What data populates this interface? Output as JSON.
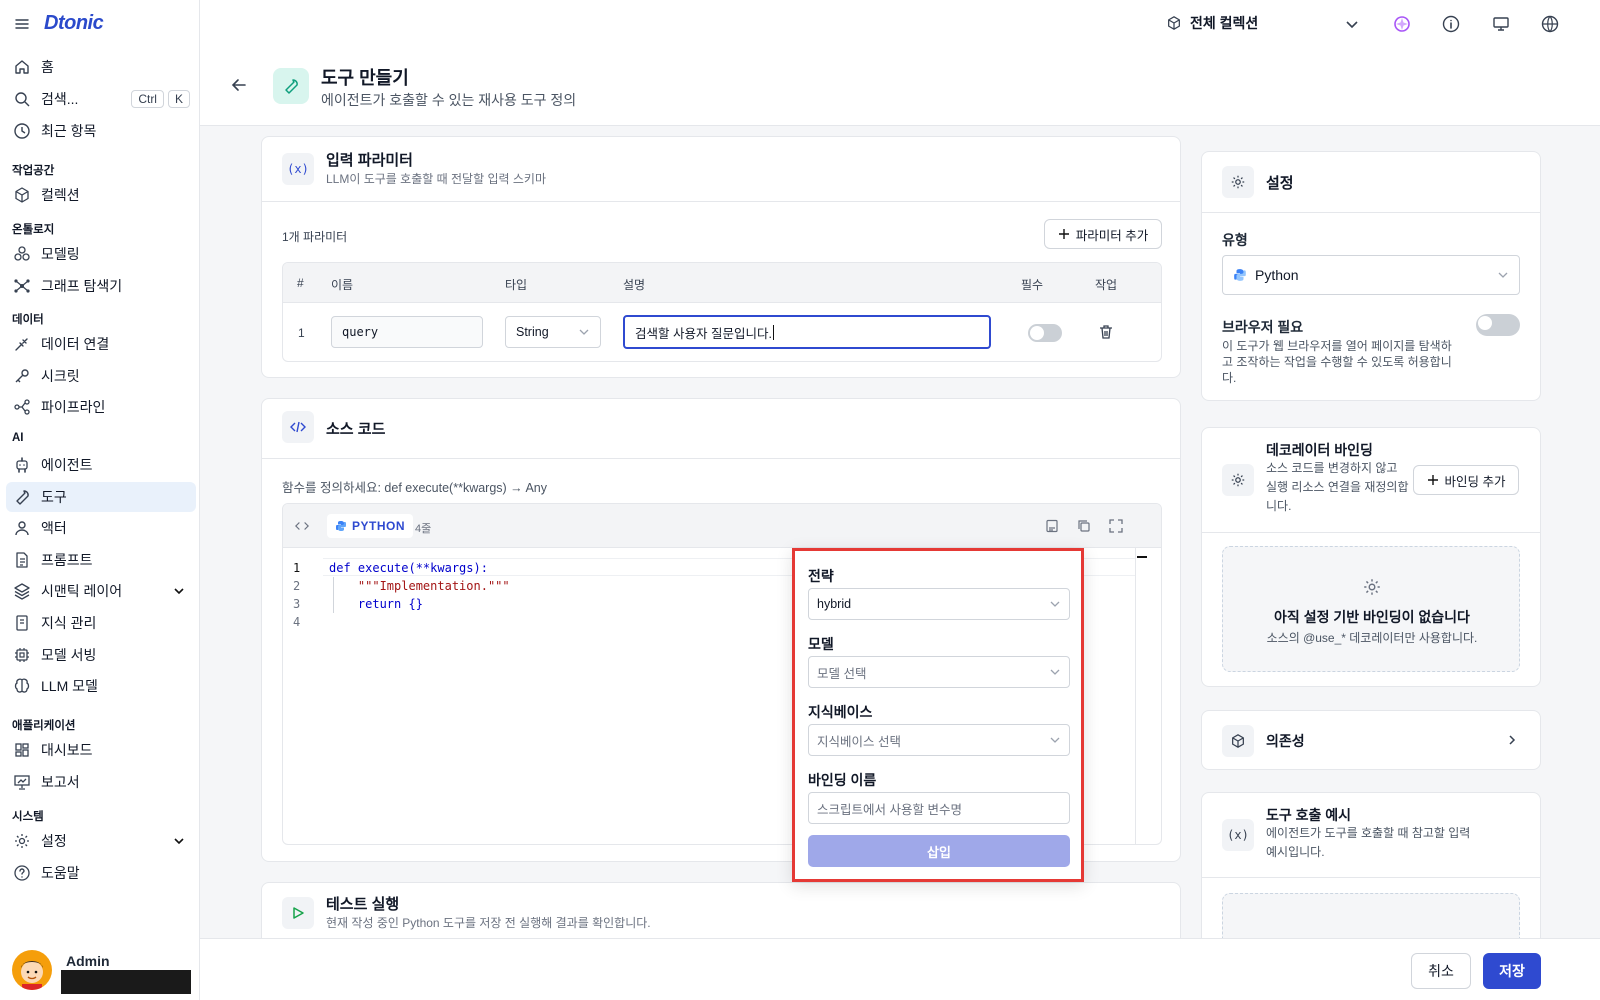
{
  "brand": {
    "logo": "Dtonic"
  },
  "sidebar": {
    "home": "홈",
    "search": "검색...",
    "search_kbd1": "Ctrl",
    "search_kbd2": "K",
    "recent": "최근 항목",
    "sec_workspace": "작업공간",
    "collection": "컬렉션",
    "sec_ontology": "온톨로지",
    "modeling": "모델링",
    "graph_explorer": "그래프 탐색기",
    "sec_data": "데이터",
    "data_connect": "데이터 연결",
    "secret": "시크릿",
    "pipeline": "파이프라인",
    "sec_ai": "AI",
    "agent": "에이전트",
    "tool": "도구",
    "actor": "액터",
    "prompt": "프롬프트",
    "semantic_layer": "시맨틱 레이어",
    "knowledge": "지식 관리",
    "model_serving": "모델 서빙",
    "llm_model": "LLM 모델",
    "sec_apps": "애플리케이션",
    "dashboard": "대시보드",
    "report": "보고서",
    "sec_system": "시스템",
    "settings": "설정",
    "help": "도움말",
    "user_name": "Admin"
  },
  "topbar": {
    "collection_selector": "전체 컬렉션"
  },
  "page": {
    "title": "도구 만들기",
    "subtitle": "에이전트가 호출할 수 있는 재사용 도구 정의"
  },
  "params": {
    "title": "입력 파라미터",
    "subtitle": "LLM이 도구를 호출할 때 전달할 입력 스키마",
    "count": "1개 파라미터",
    "add_button": "파라미터 추가",
    "icon_text": "(x)",
    "columns": {
      "num": "#",
      "name": "이름",
      "type": "타입",
      "desc": "설명",
      "required": "필수",
      "action": "작업"
    },
    "row": {
      "num": "1",
      "name": "query",
      "type": "String",
      "desc": "검색할 사용자 질문입니다."
    }
  },
  "source": {
    "title": "소스 코드",
    "hint": "함수를 정의하세요: def execute(**kwargs) → Any",
    "lang": "PYTHON",
    "lines": "4줄",
    "code": [
      {
        "n": "1",
        "text": "def execute(**kwargs):"
      },
      {
        "n": "2",
        "text": "    \"\"\"Implementation.\"\"\""
      },
      {
        "n": "3",
        "text": "    return {}"
      },
      {
        "n": "4",
        "text": ""
      }
    ]
  },
  "test": {
    "title": "테스트 실행",
    "subtitle": "현재 작성 중인 Python 도구를 저장 전 실행해 결과를 확인합니다."
  },
  "popup": {
    "strategy_label": "전략",
    "strategy_value": "hybrid",
    "model_label": "모델",
    "model_placeholder": "모델 선택",
    "kb_label": "지식베이스",
    "kb_placeholder": "지식베이스 선택",
    "binding_label": "바인딩 이름",
    "binding_placeholder": "스크립트에서 사용할 변수명",
    "insert_button": "삽입"
  },
  "settings_panel": {
    "title": "설정",
    "type_label": "유형",
    "type_value": "Python",
    "browser_label": "브라우저 필요",
    "browser_desc": "이 도구가 웹 브라우저를 열어 페이지를 탐색하고 조작하는 작업을 수행할 수 있도록 허용합니다."
  },
  "decorator": {
    "title": "데코레이터 바인딩",
    "desc": "소스 코드를 변경하지 않고 실행 리소스 연결을 재정의합니다.",
    "add_button": "바인딩 추가",
    "empty_title": "아직 설정 기반 바인딩이 없습니다",
    "empty_desc": "소스의 @use_* 데코레이터만 사용합니다."
  },
  "deps": {
    "title": "의존성"
  },
  "example": {
    "title": "도구 호출 예시",
    "desc": "에이전트가 도구를 호출할 때 참고할 입력 예시입니다.",
    "icon_text": "(x)"
  },
  "footer": {
    "cancel": "취소",
    "save": "저장"
  },
  "colors": {
    "accent": "#2f4ad0",
    "popup_border": "#e53935",
    "insert_disabled": "#9fa8e9",
    "active_nav": "#e9f1fb"
  }
}
